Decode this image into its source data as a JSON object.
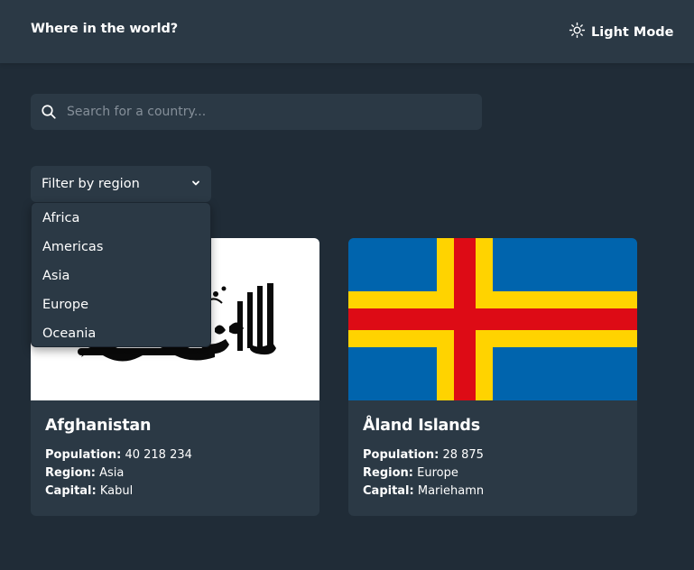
{
  "header": {
    "title": "Where in the world?",
    "theme_label": "Light Mode"
  },
  "search": {
    "placeholder": "Search for a country..."
  },
  "filter": {
    "label": "Filter by region",
    "options": [
      "Africa",
      "Americas",
      "Asia",
      "Europe",
      "Oceania"
    ]
  },
  "labels": {
    "population": "Population:",
    "region": "Region:",
    "capital": "Capital:"
  },
  "countries": [
    {
      "name": "Afghanistan",
      "population": "40 218 234",
      "region": "Asia",
      "capital": "Kabul"
    },
    {
      "name": "Åland Islands",
      "population": "28 875",
      "region": "Europe",
      "capital": "Mariehamn"
    }
  ],
  "colors": {
    "background": "#202c37",
    "element": "#2b3945",
    "text": "#ffffff",
    "placeholder": "#858f99",
    "aland_blue": "#0064ad",
    "aland_yellow": "#ffd300",
    "aland_red": "#dd0b15"
  }
}
